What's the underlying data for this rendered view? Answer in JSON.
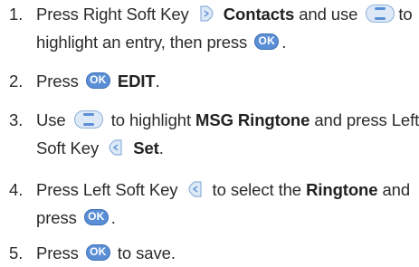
{
  "steps": [
    {
      "number": "1.",
      "line1": {
        "a": "Press Right Soft Key",
        "bold": "Contacts",
        "b": "and use",
        "c": "to"
      },
      "line2": {
        "a": "highlight an entry, then press",
        "end": "."
      }
    },
    {
      "number": "2.",
      "line1": {
        "a": "Press",
        "bold": "EDIT",
        "end": "."
      }
    },
    {
      "number": "3.",
      "line1": {
        "a": "Use",
        "b": "to highlight",
        "bold": "MSG Ringtone",
        "c": "and press Left"
      },
      "line2": {
        "a": "Soft Key",
        "bold": "Set",
        "end": "."
      }
    },
    {
      "number": "4.",
      "line1": {
        "a": "Press Left Soft Key",
        "b": "to select the",
        "bold": "Ringtone",
        "c": "and"
      },
      "line2": {
        "a": "press",
        "end": "."
      }
    },
    {
      "number": "5.",
      "line1": {
        "a": "Press",
        "b": "to save."
      }
    }
  ],
  "icons": {
    "ok_label": "OK",
    "ok_color": "#5a8fd6",
    "nav_color": "#dde9f7",
    "soft_key_color": "#dde9f7"
  }
}
